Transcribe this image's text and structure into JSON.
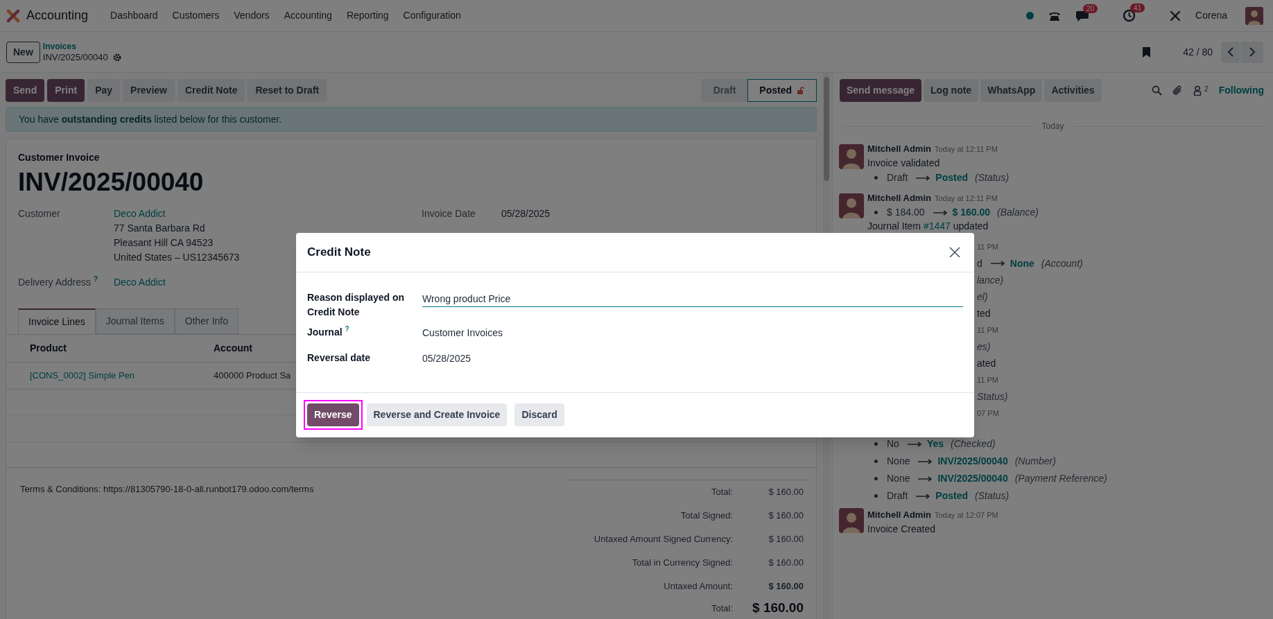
{
  "navbar": {
    "app": "Accounting",
    "menu": [
      "Dashboard",
      "Customers",
      "Vendors",
      "Accounting",
      "Reporting",
      "Configuration"
    ],
    "chat_badge": "20",
    "activity_badge": "41",
    "user": "Corena"
  },
  "control_panel": {
    "new_button": "New",
    "breadcrumb_parent": "Invoices",
    "breadcrumb_current": "INV/2025/00040",
    "pager": "42 / 80"
  },
  "actions": [
    {
      "label": "Send",
      "kind": "primary"
    },
    {
      "label": "Print",
      "kind": "primary"
    },
    {
      "label": "Pay",
      "kind": "secondary"
    },
    {
      "label": "Preview",
      "kind": "secondary"
    },
    {
      "label": "Credit Note",
      "kind": "secondary"
    },
    {
      "label": "Reset to Draft",
      "kind": "secondary"
    }
  ],
  "status_steps": [
    {
      "label": "Draft",
      "selected": false
    },
    {
      "label": "Posted",
      "selected": true
    }
  ],
  "alert": "You have **outstanding credits** listed below for this customer.",
  "invoice": {
    "type_label": "Customer Invoice",
    "number": "INV/2025/00040",
    "customer": {
      "label": "Customer",
      "value": "Deco Addict",
      "address": [
        "77 Santa Barbara Rd",
        "Pleasant Hill CA 94523",
        "United States – US12345673"
      ]
    },
    "delivery": {
      "label": "Delivery Address",
      "help": "?",
      "value": "Deco Addict"
    },
    "invoice_date": {
      "label": "Invoice Date",
      "value": "05/28/2025"
    },
    "tabs": [
      {
        "label": "Invoice Lines",
        "selected": true
      },
      {
        "label": "Journal Items",
        "selected": false
      },
      {
        "label": "Other Info",
        "selected": false
      }
    ],
    "table": {
      "columns": [
        "Product",
        "Account"
      ],
      "rows": [
        [
          "[CONS_0002] Simple Pen",
          "400000 Product Sa"
        ]
      ]
    },
    "terms": "Terms & Conditions: https://81305790-18-0-all.runbot179.odoo.com/terms",
    "totals": [
      {
        "label": "Total:",
        "value": "$ 160.00",
        "kind": "normal"
      },
      {
        "label": "Total Signed:",
        "value": "$ 160.00",
        "kind": "normal"
      },
      {
        "label": "Untaxed Amount Signed Currency:",
        "value": "$ 160.00",
        "kind": "normal"
      },
      {
        "label": "Total in Currency Signed:",
        "value": "$ 160.00",
        "kind": "normal"
      },
      {
        "label": "Untaxed Amount:",
        "value": "$ 160.00",
        "kind": "bold"
      },
      {
        "label": "Total:",
        "value": "$ 160.00",
        "kind": "grand"
      }
    ]
  },
  "chatter": {
    "buttons": [
      {
        "label": "Send message",
        "kind": "primary"
      },
      {
        "label": "Log note",
        "kind": "secondary"
      },
      {
        "label": "WhatsApp",
        "kind": "secondary"
      },
      {
        "label": "Activities",
        "kind": "secondary"
      }
    ],
    "follower_count": "2",
    "follow_label": "Following",
    "date_separator": "Today",
    "messages": [
      {
        "author": "Mitchell Admin",
        "time": "Today at 12:11 PM",
        "body": "Invoice validated",
        "changes": [
          {
            "old": "Draft",
            "new": "Posted",
            "field": "(Status)"
          }
        ]
      },
      {
        "author": "Mitchell Admin",
        "time": "Today at 12:11 PM",
        "changes": [
          {
            "old": "$ 184.00",
            "new": "$ 160.00",
            "field": "(Balance)"
          }
        ],
        "note": {
          "before": "Journal Item",
          "link": "#1447",
          "after": "updated"
        }
      }
    ],
    "covered_fragments": [
      {
        "kind": "time",
        "text": "11 PM"
      },
      {
        "kind": "change",
        "old": "d",
        "new": "None",
        "field": "(Account)"
      },
      {
        "kind": "italic",
        "text": "lance)"
      },
      {
        "kind": "italic",
        "text": "el)"
      },
      {
        "kind": "plain",
        "text": "ted"
      },
      {
        "kind": "time",
        "text": "11 PM"
      },
      {
        "kind": "italic",
        "text": "es)"
      },
      {
        "kind": "plain",
        "text": "ated"
      },
      {
        "kind": "time",
        "text": "11 PM"
      },
      {
        "kind": "italic",
        "text": "Status)"
      },
      {
        "kind": "time",
        "text": "07 PM"
      }
    ],
    "tail_changes": [
      {
        "old": "No",
        "new": "Yes",
        "field": "(Checked)"
      },
      {
        "old": "None",
        "new": "INV/2025/00040",
        "field": "(Number)"
      },
      {
        "old": "None",
        "new": "INV/2025/00040",
        "field": "(Payment Reference)"
      },
      {
        "old": "Draft",
        "new": "Posted",
        "field": "(Status)"
      }
    ],
    "last_message": {
      "author": "Mitchell Admin",
      "time": "Today at 12:07 PM",
      "body": "Invoice Created"
    }
  },
  "dialog": {
    "title": "Credit Note",
    "fields": [
      {
        "label": "Reason displayed on Credit Note",
        "value": "Wrong product Price",
        "kind": "input"
      },
      {
        "label": "Journal",
        "help": "?",
        "value": "Customer Invoices",
        "kind": "text"
      },
      {
        "label": "Reversal date",
        "value": "05/28/2025",
        "kind": "text"
      }
    ],
    "buttons": [
      {
        "label": "Reverse",
        "kind": "primary",
        "highlighted": true
      },
      {
        "label": "Reverse and Create Invoice",
        "kind": "secondary",
        "highlighted": false
      },
      {
        "label": "Discard",
        "kind": "secondary",
        "highlighted": false
      }
    ]
  }
}
